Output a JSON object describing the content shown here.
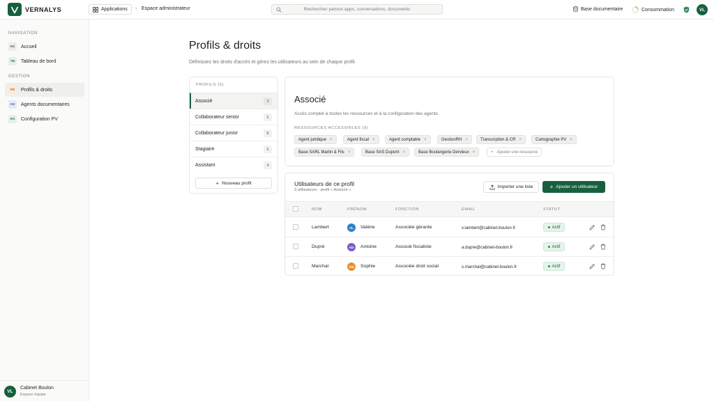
{
  "topbar": {
    "brand": "VERNALYS",
    "apps_label": "Applications",
    "breadcrumb": "Espace administrateur",
    "search_placeholder": "Rechercher partout apps, conversations, documents",
    "base_label": "Base documentaire",
    "usage_label": "Consommation",
    "user_initials": "VL"
  },
  "sidebar": {
    "nav_section": "NAVIGATION",
    "nav_items": [
      {
        "badge": "AC",
        "label": "Accueil"
      },
      {
        "badge": "TB",
        "label": "Tableau de bord"
      }
    ],
    "gestion_section": "GESTION",
    "gestion_items": [
      {
        "badge": "PD",
        "label": "Profils & droits"
      },
      {
        "badge": "AD",
        "label": "Agents documentaires"
      },
      {
        "badge": "DS",
        "label": "Configuration PV"
      }
    ],
    "footer": {
      "initials": "VL",
      "name": "Cabinet Boulon",
      "sub": "Espace équipe"
    }
  },
  "main": {
    "title": "Profils & droits",
    "subtitle": "Définissez les droits d'accès et gérez les utilisateurs au sein de chaque profil.",
    "profiles": {
      "heading": "PROFILS (5)",
      "items": [
        {
          "label": "Associé",
          "count": "3"
        },
        {
          "label": "Collaborateur senior",
          "count": "6"
        },
        {
          "label": "Collaborateur junior",
          "count": "8"
        },
        {
          "label": "Stagiaire",
          "count": "6"
        },
        {
          "label": "Assistant",
          "count": "4"
        }
      ],
      "new_label": "Nouveau profil"
    },
    "detail": {
      "title": "Associé",
      "description": "Accès complet à toutes les ressources et à la configuration des agents.",
      "resources_heading": "RESSOURCES ACCESSIBLES (9)",
      "resources": [
        "Agent juridique",
        "Agent fiscal",
        "Agent comptable",
        "GestionRH",
        "Transcription & CR",
        "Cartographie PV",
        "Base SARL Martin & Fils",
        "Base SAS Dupont",
        "Base Boulangerie Dervieux"
      ],
      "add_resource": "Ajouter une ressource"
    },
    "users": {
      "title": "Utilisateurs de ce profil",
      "subtitle": "3 utilisateurs · profil « Associé »",
      "import_label": "Importer une liste",
      "add_label": "Ajouter un utilisateur",
      "columns": {
        "nom": "NOM",
        "prenom": "PRÉNOM",
        "fonction": "FONCTION",
        "email": "EMAIL",
        "statut": "STATUT"
      },
      "rows": [
        {
          "nom": "Lambert",
          "initials": "VL",
          "avatar_color": "#2f7fd1",
          "prenom": "Valérie",
          "fonction": "Associée gérante",
          "email": "v.lambert@cabinet-boulon.fr",
          "statut": "Actif"
        },
        {
          "nom": "Dupré",
          "initials": "AD",
          "avatar_color": "#7c5cc4",
          "prenom": "Antoine",
          "fonction": "Associé fiscaliste",
          "email": "a.dupre@cabinet-boulon.fr",
          "statut": "Actif"
        },
        {
          "nom": "Marchal",
          "initials": "SM",
          "avatar_color": "#e8902b",
          "prenom": "Sophie",
          "fonction": "Associée droit social",
          "email": "s.marchal@cabinet-boulon.fr",
          "statut": "Actif"
        }
      ]
    }
  },
  "colors": {
    "accent": "#17603d",
    "status_bg": "#e6f3ea"
  }
}
